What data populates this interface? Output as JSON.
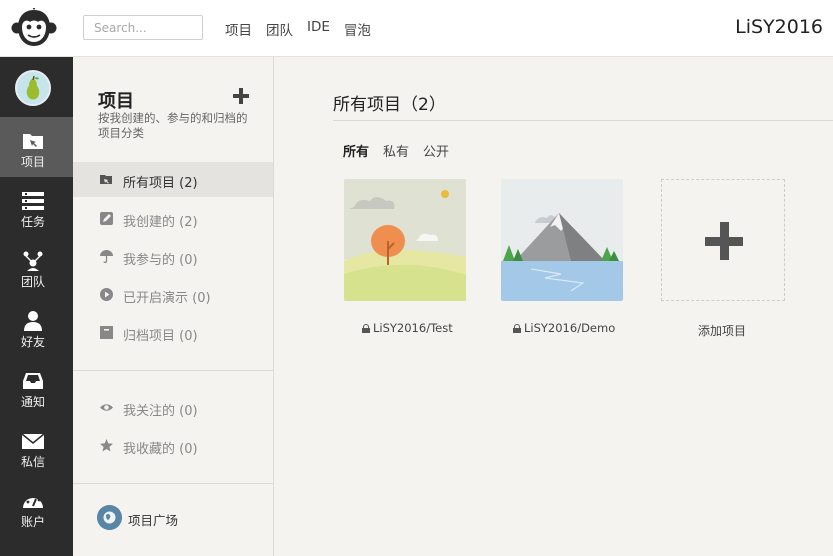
{
  "header": {
    "search_placeholder": "Search...",
    "nav": [
      "项目",
      "团队",
      "IDE",
      "冒泡"
    ],
    "username": "LiSY2016"
  },
  "sidebar": {
    "items": [
      {
        "label": "项目",
        "icon": "folder-icon",
        "active": true
      },
      {
        "label": "任务",
        "icon": "tasks-icon"
      },
      {
        "label": "团队",
        "icon": "team-icon"
      },
      {
        "label": "好友",
        "icon": "user-icon"
      },
      {
        "label": "通知",
        "icon": "inbox-icon"
      },
      {
        "label": "私信",
        "icon": "mail-icon"
      },
      {
        "label": "账户",
        "icon": "dashboard-icon"
      }
    ]
  },
  "panel": {
    "title": "项目",
    "description": "按我创建的、参与的和归档的项目分类",
    "menu": [
      {
        "label": "所有项目 (2)",
        "icon": "folder-open-icon",
        "active": true
      },
      {
        "label": "我创建的 (2)",
        "icon": "edit-icon"
      },
      {
        "label": "我参与的 (0)",
        "icon": "umbrella-icon"
      },
      {
        "label": "已开启演示 (0)",
        "icon": "play-icon"
      },
      {
        "label": "归档项目 (0)",
        "icon": "archive-icon"
      },
      {
        "label": "我关注的 (0)",
        "icon": "eye-icon"
      },
      {
        "label": "我收藏的 (0)",
        "icon": "star-icon"
      }
    ],
    "plaza_label": "项目广场"
  },
  "main": {
    "title": "所有项目（2）",
    "filters": [
      "所有",
      "私有",
      "公开"
    ],
    "projects": [
      {
        "name": "LiSY2016/Test"
      },
      {
        "name": "LiSY2016/Demo"
      }
    ],
    "add_label": "添加项目"
  }
}
